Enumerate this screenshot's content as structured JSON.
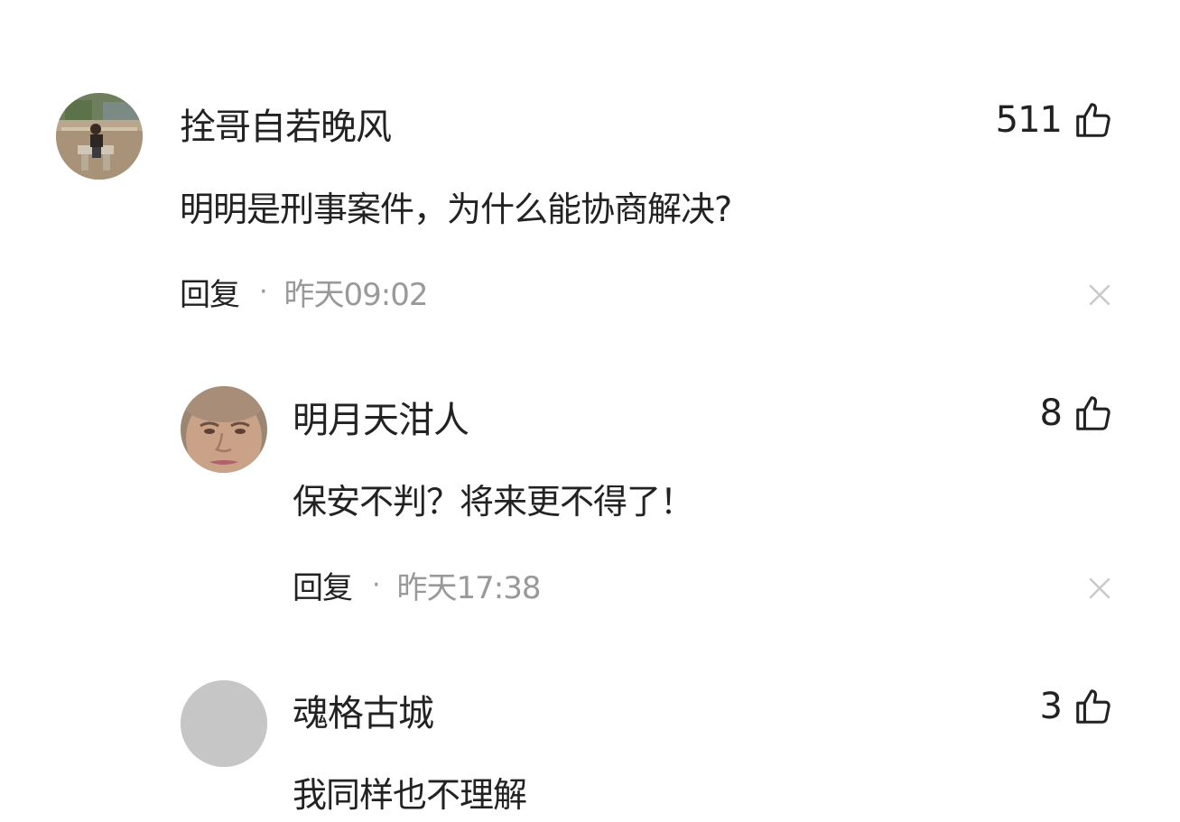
{
  "comments": [
    {
      "username": "拴哥自若晚风",
      "text": "明明是刑事案件，为什么能协商解决?",
      "likes": "511",
      "reply_label": "回复",
      "separator": "·",
      "time": "昨天09:02",
      "avatar": "photo-outdoor-person-sitting"
    },
    {
      "username": "明月天泔人",
      "text": "保安不判？将来更不得了！",
      "likes": "8",
      "reply_label": "回复",
      "separator": "·",
      "time": "昨天17:38",
      "avatar": "photo-face-closeup"
    },
    {
      "username": "魂格古城",
      "text": "我同样也不理解",
      "likes": "3",
      "avatar": "default-gray"
    }
  ],
  "icons": {
    "like": "thumbs-up-icon",
    "close": "close-icon"
  },
  "colors": {
    "text_primary": "#222222",
    "text_secondary": "#999999",
    "icon_close": "#c8c8c8",
    "default_avatar": "#c6c6c6"
  }
}
